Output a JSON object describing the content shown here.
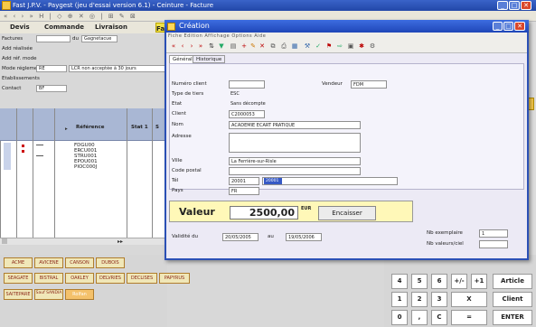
{
  "main": {
    "title": "Fast J.P.V. - Paygest (jeu d'essai version 6.1) - Ceinture - Facture",
    "toolbar": "«  ‹  ›  »  H  |  ◇  ⊕  ✕  ◎  |  ⊞  ✎  ⊠",
    "tabs": [
      "Devis",
      "Commande",
      "Livraison",
      "Fa"
    ],
    "fields": [
      {
        "label": "Factures",
        "value": "",
        "extra_label": "du",
        "extra_value": "Gagnetacue"
      },
      {
        "label": "Add réalisée",
        "value": ""
      },
      {
        "label": "Add réf. mode",
        "value": ""
      },
      {
        "label": "Mode réglement",
        "value": "RE",
        "extra_value": "LCR non acceptée à 30 jours"
      },
      {
        "label": "Etablissements",
        "value": ""
      },
      {
        "label": "Contact",
        "value": "BF"
      }
    ],
    "grid": {
      "headers": [
        "Référence",
        "Stat 1",
        "S"
      ],
      "rows": [
        "FDGU00",
        "ERCU001",
        "STRU001",
        "EPOU001",
        "PIOC000J"
      ]
    },
    "buttons_row1": [
      "ACME",
      "AVICENE",
      "CANSON",
      "DUBOIS"
    ],
    "buttons_row2": [
      "SEAGATE",
      "BISTRAL",
      "OAKLEY",
      "DELVRIES",
      "DECLISES",
      "PAPYRUS"
    ],
    "buttons_row3": [
      "SAITEPARE",
      "Sauf SANDIA",
      "Rolfan"
    ],
    "numpad": [
      [
        "4",
        "5",
        "6",
        "+/-",
        "+1",
        "Article"
      ],
      [
        "1",
        "2",
        "3",
        "X",
        "Client"
      ],
      [
        "0",
        ",",
        "C",
        "=",
        "ENTER"
      ]
    ]
  },
  "dialog": {
    "title": "Création",
    "menu": "Fiche  Edition  Affichage  Options  Aide",
    "tabs": [
      "Général",
      "Historique"
    ],
    "fields": {
      "numero_label": "Numéro client",
      "numero": "",
      "vendeur_label": "Vendeur",
      "vendeur": "FDM",
      "type_label": "Type de tiers",
      "type": "ESC",
      "etat_label": "Etat",
      "etat": "Sans décompte",
      "client_label": "Client",
      "client": "C2000053",
      "nom_label": "Nom",
      "nom": "ACADEMIE ECART PRATIQUE",
      "adresse_label": "Adresse",
      "adresse": "",
      "ville_label": "Ville",
      "ville": "La Ferrière-sur-Risle",
      "cp_label": "Code postal",
      "cp": "",
      "tel_label": "Tél",
      "tel": "20001",
      "tel2": "20001",
      "pays_label": "Pays",
      "pays": "FR"
    },
    "valeur_label": "Valeur",
    "valeur": "2500,00",
    "unit": "EUR",
    "encaisser": "Encaisser",
    "validite_label": "Validité du",
    "date_from": "20/05/2005",
    "au_label": "au",
    "date_to": "19/05/2006",
    "exemplaire_label": "Nb exemplaire",
    "exemplaire": "1",
    "nb_valeurs_label": "Nb valeurs/ciel",
    "nb_valeurs": ""
  }
}
